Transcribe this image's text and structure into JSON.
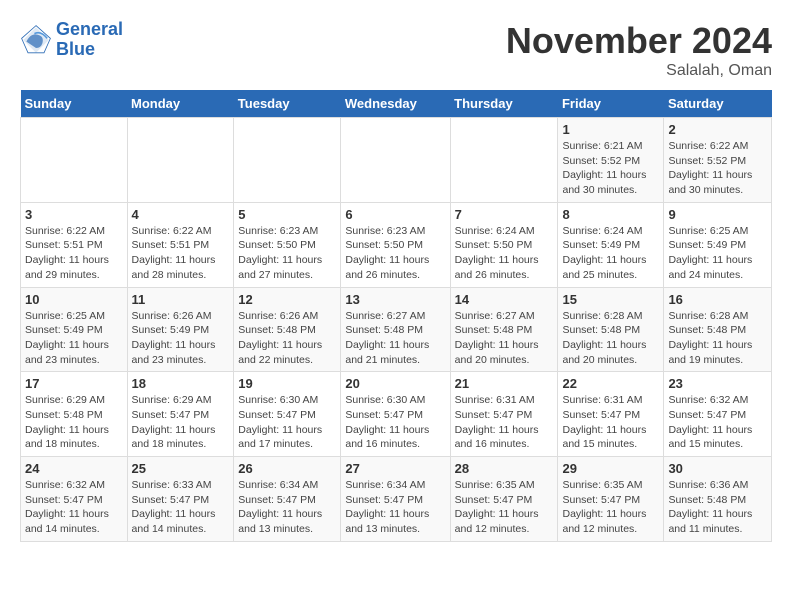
{
  "logo": {
    "line1": "General",
    "line2": "Blue"
  },
  "title": "November 2024",
  "location": "Salalah, Oman",
  "days_of_week": [
    "Sunday",
    "Monday",
    "Tuesday",
    "Wednesday",
    "Thursday",
    "Friday",
    "Saturday"
  ],
  "weeks": [
    [
      {
        "day": "",
        "info": ""
      },
      {
        "day": "",
        "info": ""
      },
      {
        "day": "",
        "info": ""
      },
      {
        "day": "",
        "info": ""
      },
      {
        "day": "",
        "info": ""
      },
      {
        "day": "1",
        "info": "Sunrise: 6:21 AM\nSunset: 5:52 PM\nDaylight: 11 hours and 30 minutes."
      },
      {
        "day": "2",
        "info": "Sunrise: 6:22 AM\nSunset: 5:52 PM\nDaylight: 11 hours and 30 minutes."
      }
    ],
    [
      {
        "day": "3",
        "info": "Sunrise: 6:22 AM\nSunset: 5:51 PM\nDaylight: 11 hours and 29 minutes."
      },
      {
        "day": "4",
        "info": "Sunrise: 6:22 AM\nSunset: 5:51 PM\nDaylight: 11 hours and 28 minutes."
      },
      {
        "day": "5",
        "info": "Sunrise: 6:23 AM\nSunset: 5:50 PM\nDaylight: 11 hours and 27 minutes."
      },
      {
        "day": "6",
        "info": "Sunrise: 6:23 AM\nSunset: 5:50 PM\nDaylight: 11 hours and 26 minutes."
      },
      {
        "day": "7",
        "info": "Sunrise: 6:24 AM\nSunset: 5:50 PM\nDaylight: 11 hours and 26 minutes."
      },
      {
        "day": "8",
        "info": "Sunrise: 6:24 AM\nSunset: 5:49 PM\nDaylight: 11 hours and 25 minutes."
      },
      {
        "day": "9",
        "info": "Sunrise: 6:25 AM\nSunset: 5:49 PM\nDaylight: 11 hours and 24 minutes."
      }
    ],
    [
      {
        "day": "10",
        "info": "Sunrise: 6:25 AM\nSunset: 5:49 PM\nDaylight: 11 hours and 23 minutes."
      },
      {
        "day": "11",
        "info": "Sunrise: 6:26 AM\nSunset: 5:49 PM\nDaylight: 11 hours and 23 minutes."
      },
      {
        "day": "12",
        "info": "Sunrise: 6:26 AM\nSunset: 5:48 PM\nDaylight: 11 hours and 22 minutes."
      },
      {
        "day": "13",
        "info": "Sunrise: 6:27 AM\nSunset: 5:48 PM\nDaylight: 11 hours and 21 minutes."
      },
      {
        "day": "14",
        "info": "Sunrise: 6:27 AM\nSunset: 5:48 PM\nDaylight: 11 hours and 20 minutes."
      },
      {
        "day": "15",
        "info": "Sunrise: 6:28 AM\nSunset: 5:48 PM\nDaylight: 11 hours and 20 minutes."
      },
      {
        "day": "16",
        "info": "Sunrise: 6:28 AM\nSunset: 5:48 PM\nDaylight: 11 hours and 19 minutes."
      }
    ],
    [
      {
        "day": "17",
        "info": "Sunrise: 6:29 AM\nSunset: 5:48 PM\nDaylight: 11 hours and 18 minutes."
      },
      {
        "day": "18",
        "info": "Sunrise: 6:29 AM\nSunset: 5:47 PM\nDaylight: 11 hours and 18 minutes."
      },
      {
        "day": "19",
        "info": "Sunrise: 6:30 AM\nSunset: 5:47 PM\nDaylight: 11 hours and 17 minutes."
      },
      {
        "day": "20",
        "info": "Sunrise: 6:30 AM\nSunset: 5:47 PM\nDaylight: 11 hours and 16 minutes."
      },
      {
        "day": "21",
        "info": "Sunrise: 6:31 AM\nSunset: 5:47 PM\nDaylight: 11 hours and 16 minutes."
      },
      {
        "day": "22",
        "info": "Sunrise: 6:31 AM\nSunset: 5:47 PM\nDaylight: 11 hours and 15 minutes."
      },
      {
        "day": "23",
        "info": "Sunrise: 6:32 AM\nSunset: 5:47 PM\nDaylight: 11 hours and 15 minutes."
      }
    ],
    [
      {
        "day": "24",
        "info": "Sunrise: 6:32 AM\nSunset: 5:47 PM\nDaylight: 11 hours and 14 minutes."
      },
      {
        "day": "25",
        "info": "Sunrise: 6:33 AM\nSunset: 5:47 PM\nDaylight: 11 hours and 14 minutes."
      },
      {
        "day": "26",
        "info": "Sunrise: 6:34 AM\nSunset: 5:47 PM\nDaylight: 11 hours and 13 minutes."
      },
      {
        "day": "27",
        "info": "Sunrise: 6:34 AM\nSunset: 5:47 PM\nDaylight: 11 hours and 13 minutes."
      },
      {
        "day": "28",
        "info": "Sunrise: 6:35 AM\nSunset: 5:47 PM\nDaylight: 11 hours and 12 minutes."
      },
      {
        "day": "29",
        "info": "Sunrise: 6:35 AM\nSunset: 5:47 PM\nDaylight: 11 hours and 12 minutes."
      },
      {
        "day": "30",
        "info": "Sunrise: 6:36 AM\nSunset: 5:48 PM\nDaylight: 11 hours and 11 minutes."
      }
    ]
  ]
}
